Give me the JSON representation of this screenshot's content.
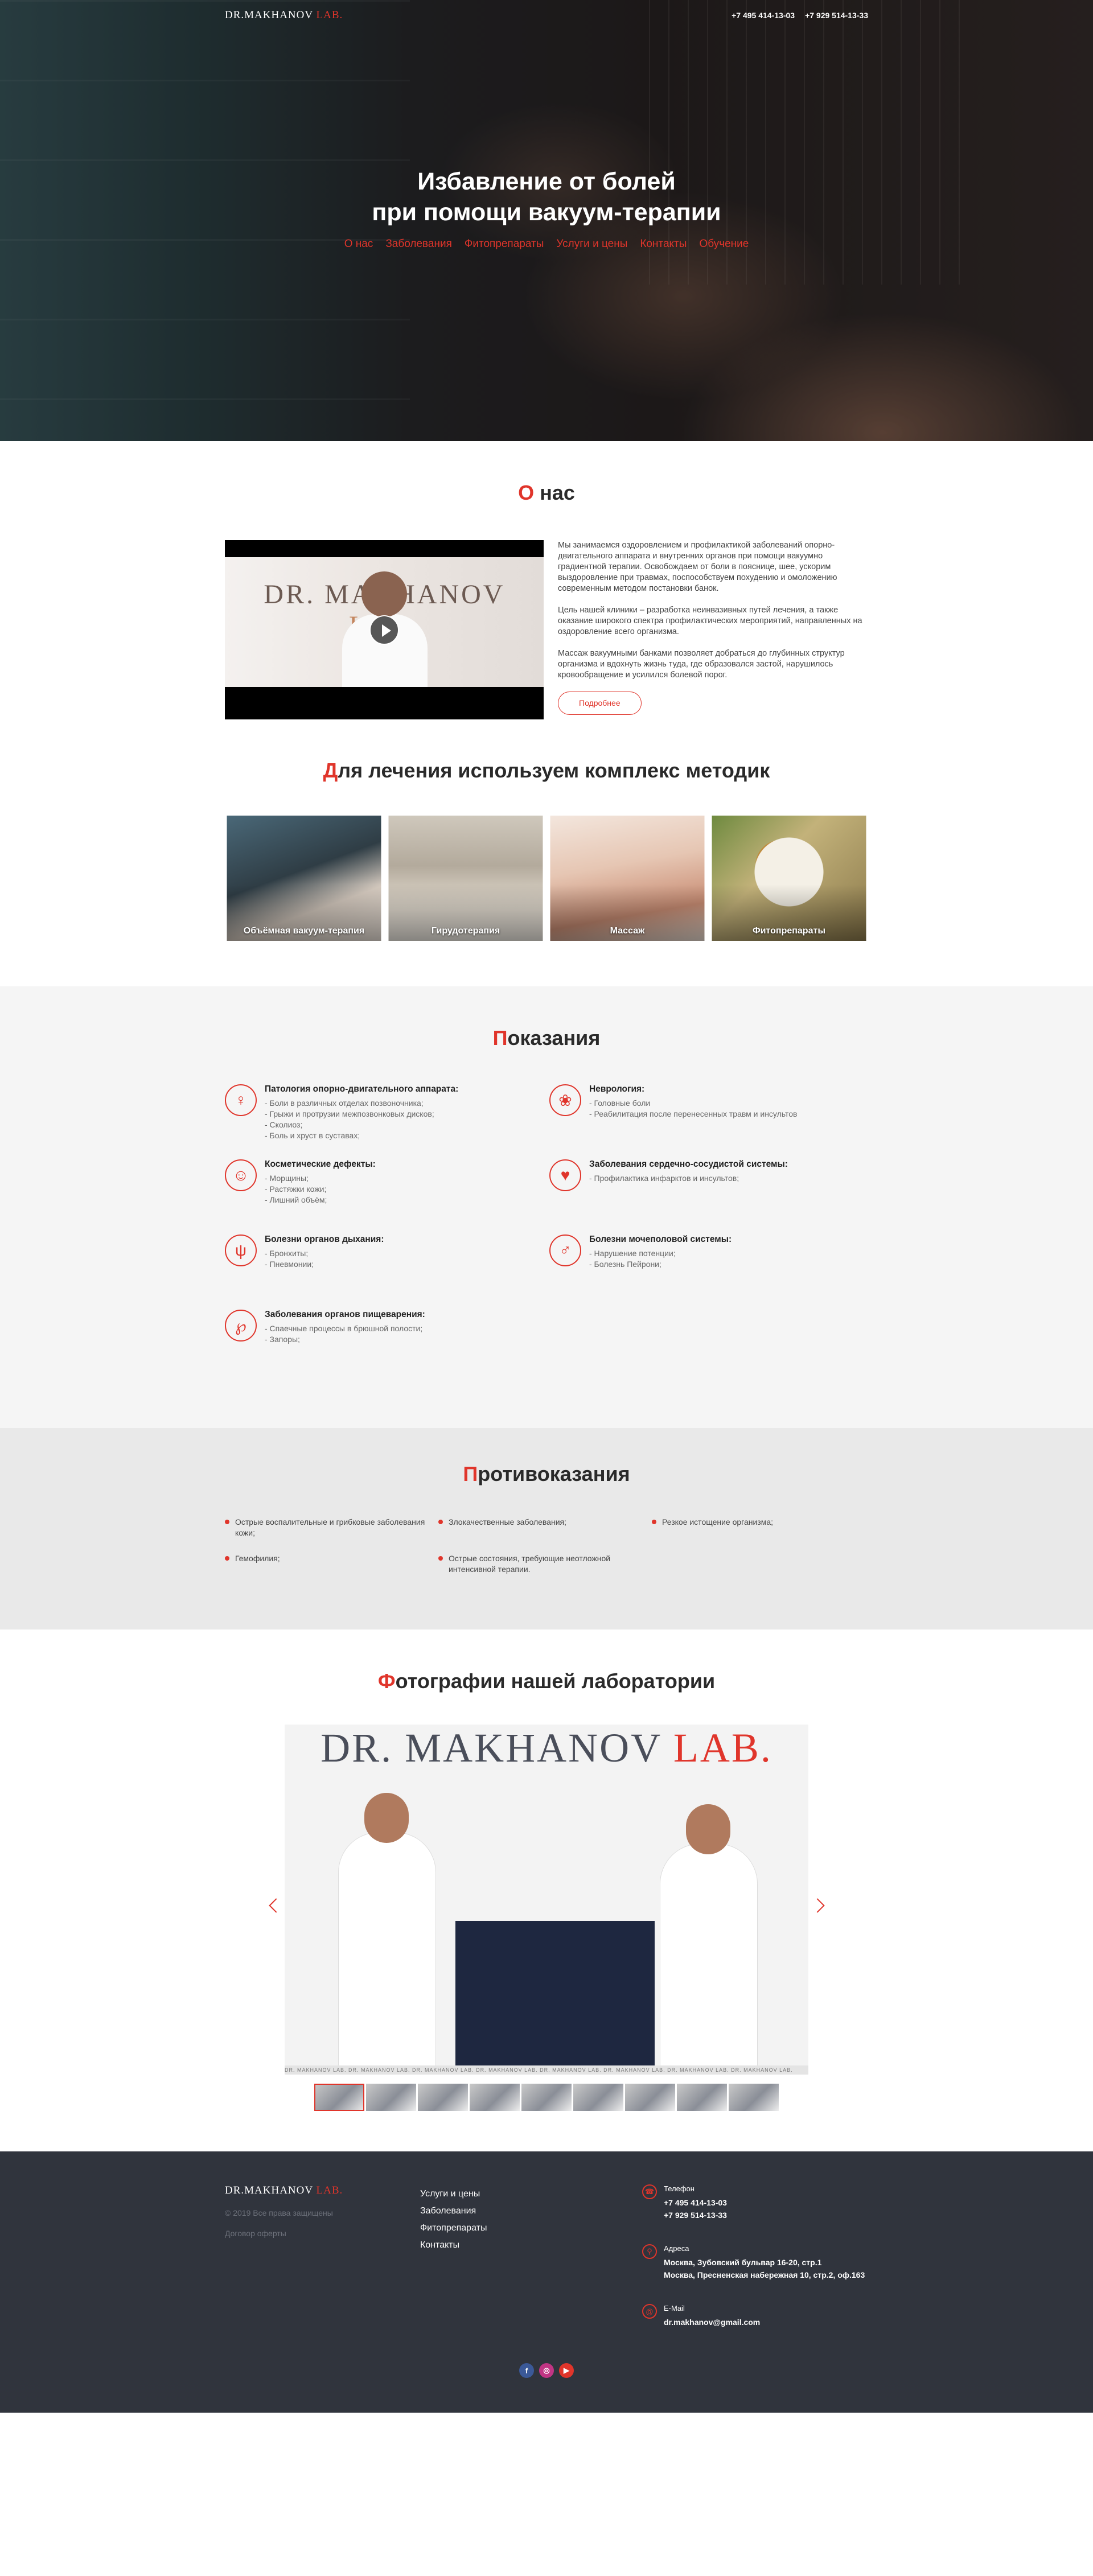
{
  "header": {
    "logo_main": "DR.MAKHANOV",
    "logo_lab": "LAB.",
    "phone1": "+7 495 414-13-03",
    "phone2": "+7 929 514-13-33"
  },
  "hero": {
    "title_line1": "Избавление от болей",
    "title_line2": "при помощи вакуум-терапии",
    "nav": [
      "О нас",
      "Заболевания",
      "Фитопрепараты",
      "Услуги и цены",
      "Контакты",
      "Обучение"
    ]
  },
  "about": {
    "title_first": "О",
    "title_rest": " нас",
    "video_brand_main": "DR. MAKHANOV",
    "video_brand_lab": "LAB.",
    "paragraphs": [
      "Мы занимаемся оздоровлением и профилактикой заболеваний опорно-двигательного аппарата и внутренних органов при помощи вакуумно градиентной терапии. Освобождаем от боли в пояснице, шее, ускорим выздоровление при травмах, поспособствуем похудению и омоложению современным методом постановки банок.",
      "Цель нашей клиники – разработка неинвазивных путей лечения, а также оказание широкого спектра профилактических мероприятий, направленных на оздоровление всего организма.",
      "Массаж вакуумными банками позволяет добраться до глубинных структур организма и вдохнуть жизнь туда, где образовался застой, нарушилось кровообращение и усилился болевой порог."
    ],
    "more_button": "Подробнее"
  },
  "methods": {
    "title_first": "Д",
    "title_rest": "ля лечения используем комплекс методик",
    "items": [
      "Объёмная вакуум-терапия",
      "Гирудотерапия",
      "Массаж",
      "Фитопрепараты"
    ]
  },
  "indications": {
    "title_first": "П",
    "title_rest": "оказания",
    "items": [
      {
        "icon": "spine-icon",
        "glyph": "♀",
        "title": "Патология опорно-двигательного аппарата:",
        "lines": [
          "- Боли в различных отделах позвоночника;",
          "- Грыжи и протрузии межпозвонковых дисков;",
          "- Сколиоз;",
          "- Боль и хруст в суставах;"
        ]
      },
      {
        "icon": "brain-icon",
        "glyph": "❀",
        "title": "Неврология:",
        "lines": [
          "- Головные боли",
          "- Реабилитация после перенесенных травм и инсультов"
        ]
      },
      {
        "icon": "face-icon",
        "glyph": "☺",
        "title": "Косметические дефекты:",
        "lines": [
          "- Морщины;",
          "- Растяжки кожи;",
          "- Лишний объём;"
        ]
      },
      {
        "icon": "heart-icon",
        "glyph": "♥",
        "title": "Заболевания сердечно-сосудистой системы:",
        "lines": [
          "- Профилактика инфарктов и инсультов;"
        ]
      },
      {
        "icon": "lungs-icon",
        "glyph": "ψ",
        "title": "Болезни органов дыхания:",
        "lines": [
          "- Бронхиты;",
          "- Пневмонии;"
        ]
      },
      {
        "icon": "kidneys-icon",
        "glyph": "♂",
        "title": "Болезни мочеполовой системы:",
        "lines": [
          "- Нарушение потенции;",
          "- Болезнь Пейрони;"
        ]
      },
      {
        "icon": "stomach-icon",
        "glyph": "℘",
        "title": "Заболевания органов пищеварения:",
        "lines": [
          "- Спаечные процессы в брюшной полости;",
          "- Запоры;"
        ]
      }
    ]
  },
  "contra": {
    "title_first": "П",
    "title_rest": "ротивоказания",
    "items": [
      "Острые воспалительные и грибковые заболевания кожи;",
      "Злокачественные заболевания;",
      "Резкое истощение организма;",
      "Гемофилия;",
      "Острые состояния, требующие неотложной интенсивной терапии."
    ]
  },
  "photos": {
    "title_first": "Ф",
    "title_rest": "отографии нашей лаборатории",
    "slide_brand_main": "DR. MAKHANOV",
    "slide_brand_lab": "LAB.",
    "strip_text": "DR. MAKHANOV LAB. DR. MAKHANOV LAB. DR. MAKHANOV LAB. DR. MAKHANOV LAB. DR. MAKHANOV LAB. DR. MAKHANOV LAB. DR. MAKHANOV LAB. DR. MAKHANOV LAB.",
    "thumb_count": 9
  },
  "footer": {
    "logo_main": "DR.MAKHANOV",
    "logo_lab": "LAB.",
    "copyright": "© 2019 Все права защищены",
    "offer": "Договор оферты",
    "links": [
      "Услуги и цены",
      "Заболевания",
      "Фитопрепараты",
      "Контакты"
    ],
    "phone_label": "Телефон",
    "phone1": "+7 495 414-13-03",
    "phone2": "+7 929 514-13-33",
    "address_label": "Адреса",
    "address1": "Москва, Зубовский бульвар 16-20, стр.1",
    "address2": "Москва, Пресненская набережная 10, стр.2, оф.163",
    "email_label": "E-Mail",
    "email": "dr.makhanov@gmail.com",
    "social": [
      "f",
      "◎",
      "▶"
    ]
  },
  "colors": {
    "accent": "#e0352b",
    "footer_bg": "#30343d",
    "indications_bg": "#f5f5f5",
    "contra_bg": "#e9e9e9"
  }
}
